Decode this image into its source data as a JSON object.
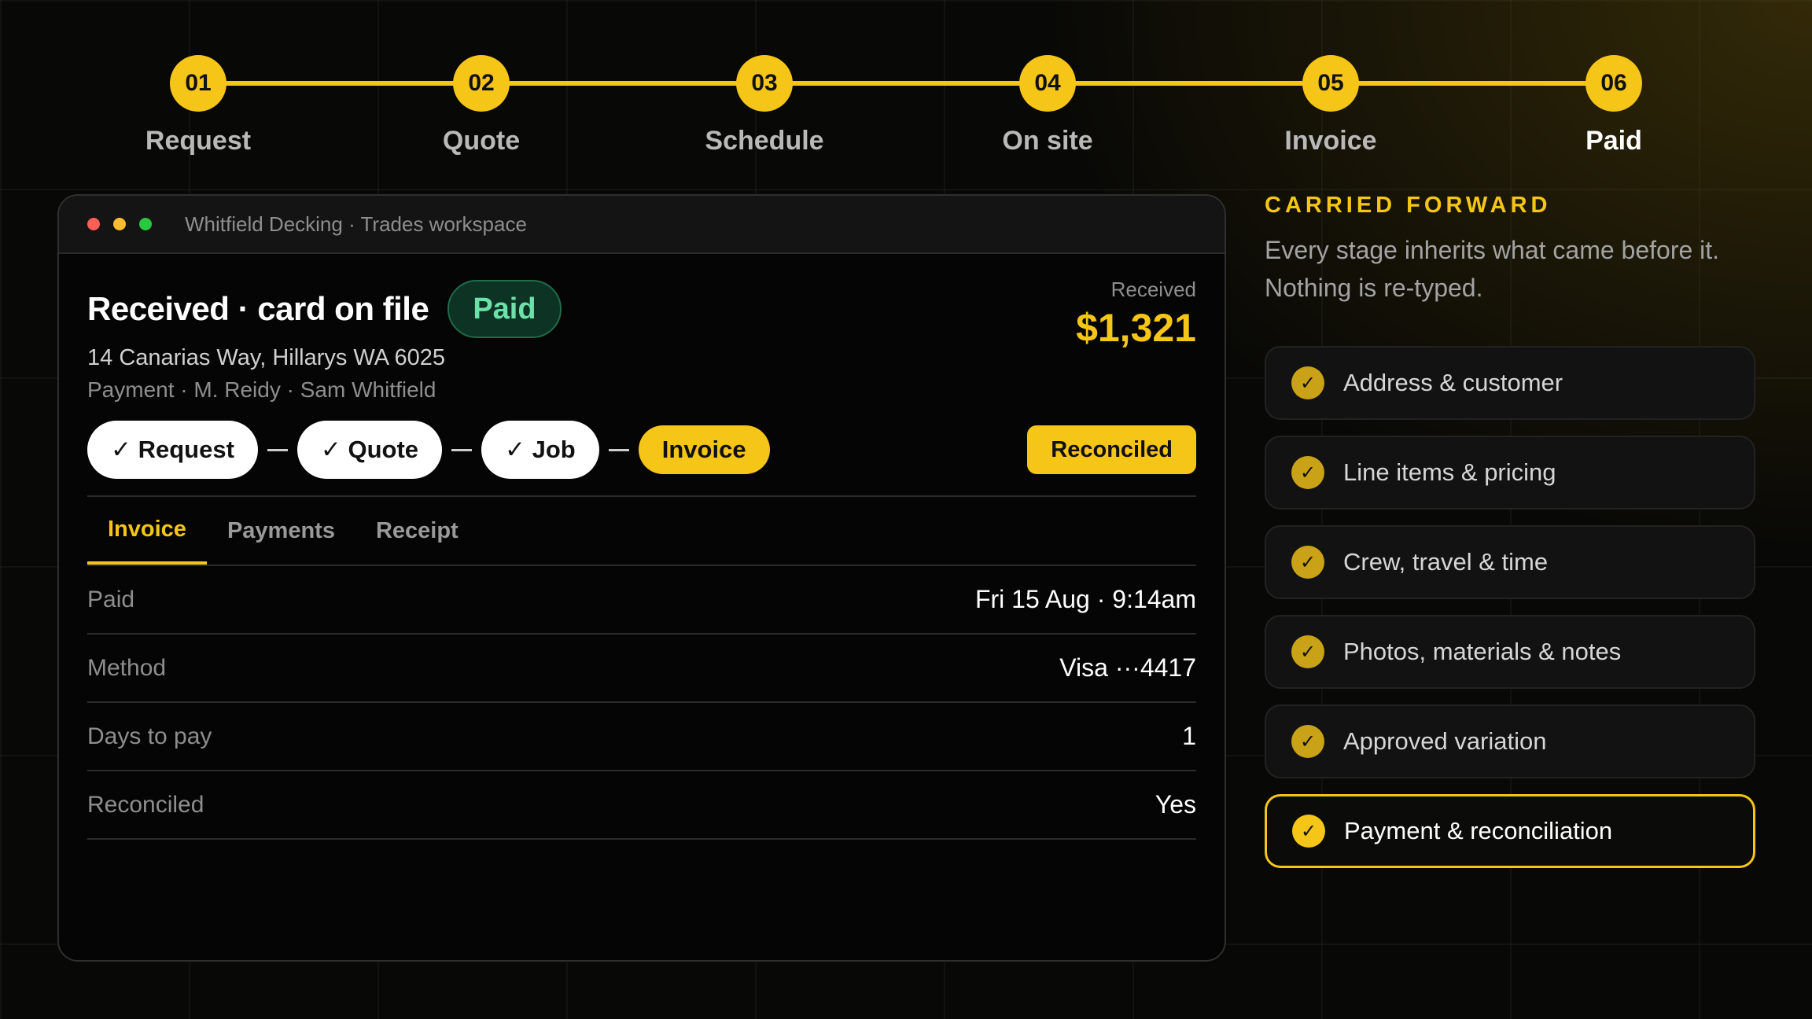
{
  "stepper": {
    "steps": [
      {
        "number": "01",
        "label": "Request"
      },
      {
        "number": "02",
        "label": "Quote"
      },
      {
        "number": "03",
        "label": "Schedule"
      },
      {
        "number": "04",
        "label": "On site"
      },
      {
        "number": "05",
        "label": "Invoice"
      },
      {
        "number": "06",
        "label": "Paid"
      }
    ],
    "current_step": "Paid"
  },
  "window": {
    "title": "Whitfield Decking · Trades workspace",
    "record": {
      "title": "Received · card on file",
      "status_badge": "Paid",
      "address": "14 Canarias Way, Hillarys WA 6025",
      "meta": "Payment · M. Reidy · Sam Whitfield",
      "amount_label": "Received",
      "amount_value": "$1,321"
    },
    "chain": [
      {
        "label": "✓ Request"
      },
      {
        "label": "✓ Quote"
      },
      {
        "label": "✓ Job"
      },
      {
        "label": "Invoice"
      }
    ],
    "reconciled_button": "Reconciled",
    "tabs": [
      {
        "label": "Invoice",
        "active": true
      },
      {
        "label": "Payments",
        "active": false
      },
      {
        "label": "Receipt",
        "active": false
      }
    ],
    "details": [
      {
        "key": "Paid",
        "value": "Fri 15 Aug · 9:14am"
      },
      {
        "key": "Method",
        "value": "Visa ···4417"
      },
      {
        "key": "Days to pay",
        "value": "1"
      },
      {
        "key": "Reconciled",
        "value": "Yes"
      }
    ]
  },
  "panel": {
    "heading": "CARRIED FORWARD",
    "description_line1": "Every stage inherits what came before it.",
    "description_line2": "Nothing is re-typed.",
    "items": [
      {
        "label": "Address & customer"
      },
      {
        "label": "Line items & pricing"
      },
      {
        "label": "Crew, travel & time"
      },
      {
        "label": "Photos, materials & notes"
      },
      {
        "label": "Approved variation"
      },
      {
        "label": "Payment & reconciliation"
      }
    ]
  },
  "colors": {
    "accent": "#f5c518",
    "paid_green": "#6ee0a8",
    "background": "#080806"
  },
  "icons": {
    "check": "check-icon"
  }
}
